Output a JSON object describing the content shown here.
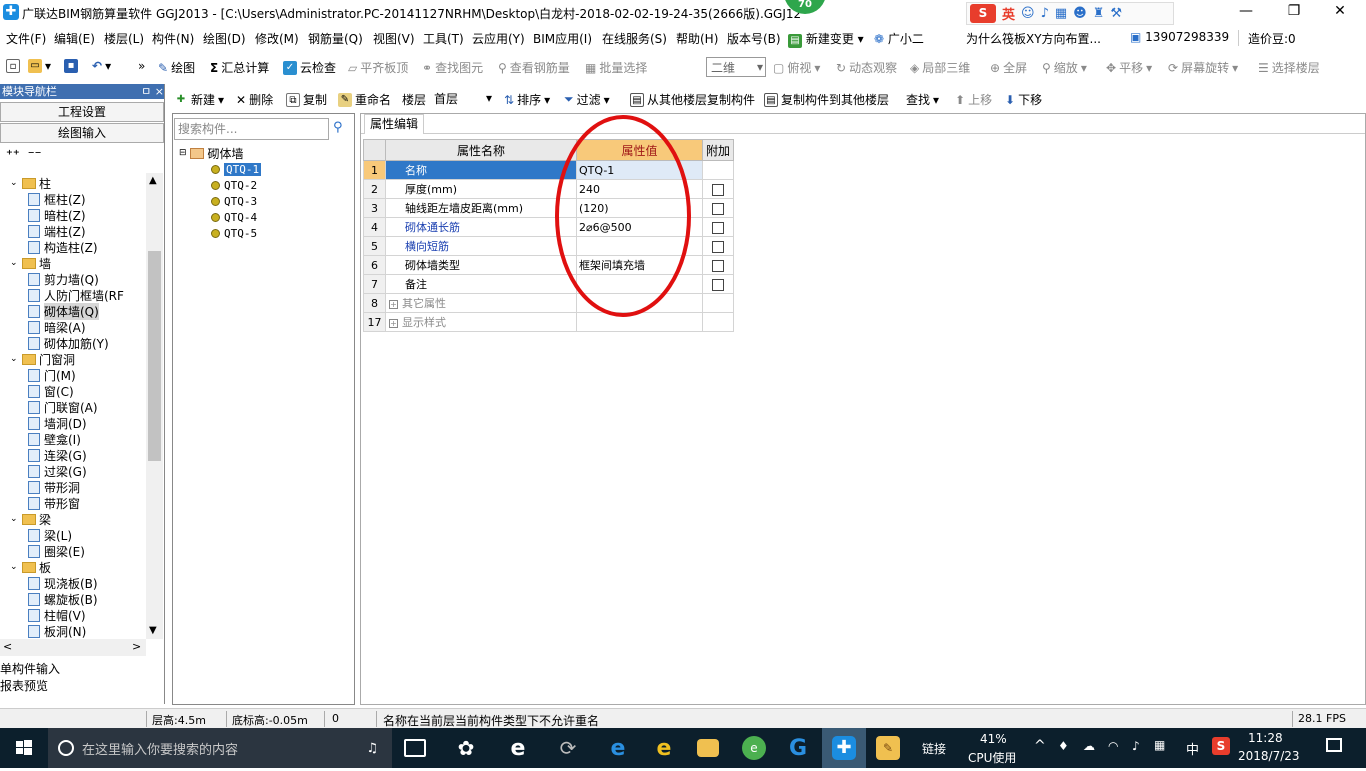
{
  "app": {
    "title": "广联达BIM钢筋算量软件 GGJ2013 - [C:\\Users\\Administrator.PC-20141127NRHM\\Desktop\\白龙村-2018-02-02-19-24-35(2666版).GGJ12",
    "badge": "70",
    "window_controls": [
      "—",
      "❐",
      "✕"
    ]
  },
  "ime": {
    "logo": "S",
    "mode": "英",
    "icons": [
      "smiley-icon",
      "microphone-icon",
      "keyboard-icon",
      "users-icon",
      "shirt-icon",
      "wrench-icon"
    ]
  },
  "menubar": {
    "items": [
      "文件(F)",
      "编辑(E)",
      "楼层(L)",
      "构件(N)",
      "绘图(D)",
      "修改(M)",
      "钢筋量(Q)",
      "视图(V)",
      "工具(T)",
      "云应用(Y)",
      "BIM应用(I)",
      "在线服务(S)",
      "帮助(H)",
      "版本号(B)"
    ],
    "new_change": "新建变更",
    "assistant": "广小二",
    "question": "为什么筏板XY方向布置...",
    "phone": "13907298339",
    "cost_bean": "造价豆:0"
  },
  "toolbar1": {
    "draw": "绘图",
    "sum_calc": "汇总计算",
    "cloud_check": "云检查",
    "align_slab": "平齐板顶",
    "find_element": "查找图元",
    "view_rebar": "查看钢筋量",
    "batch_select": "批量选择",
    "view_mode": "二维",
    "top_view": "俯视",
    "dynamic_view": "动态观察",
    "local_3d": "局部三维",
    "fullscreen": "全屏",
    "zoom": "缩放",
    "pan": "平移",
    "rotate": "屏幕旋转",
    "select_floor": "选择楼层"
  },
  "toolbar2": {
    "new": "新建",
    "delete": "删除",
    "copy": "复制",
    "rename": "重命名",
    "floor_label": "楼层",
    "floor_value": "首层",
    "sort": "排序",
    "filter": "过滤",
    "copy_from_floor": "从其他楼层复制构件",
    "copy_to_floor": "复制构件到其他楼层",
    "find": "查找",
    "move_up": "上移",
    "move_down": "下移"
  },
  "leftnav": {
    "title": "模块导航栏",
    "header_icons": "ㅁ ×",
    "btn_project_settings": "工程设置",
    "btn_draw_input": "绘图输入",
    "btn_single_input": "单构件输入",
    "btn_report_preview": "报表预览",
    "tree": [
      {
        "label": "柱",
        "level": 0,
        "folder": true
      },
      {
        "label": "框柱(Z)",
        "level": 1
      },
      {
        "label": "暗柱(Z)",
        "level": 1
      },
      {
        "label": "端柱(Z)",
        "level": 1
      },
      {
        "label": "构造柱(Z)",
        "level": 1
      },
      {
        "label": "墙",
        "level": 0,
        "folder": true
      },
      {
        "label": "剪力墙(Q)",
        "level": 1
      },
      {
        "label": "人防门框墙(RF",
        "level": 1
      },
      {
        "label": "砌体墙(Q)",
        "level": 1,
        "selected": true
      },
      {
        "label": "暗梁(A)",
        "level": 1
      },
      {
        "label": "砌体加筋(Y)",
        "level": 1
      },
      {
        "label": "门窗洞",
        "level": 0,
        "folder": true
      },
      {
        "label": "门(M)",
        "level": 1
      },
      {
        "label": "窗(C)",
        "level": 1
      },
      {
        "label": "门联窗(A)",
        "level": 1
      },
      {
        "label": "墙洞(D)",
        "level": 1
      },
      {
        "label": "壁龛(I)",
        "level": 1
      },
      {
        "label": "连梁(G)",
        "level": 1
      },
      {
        "label": "过梁(G)",
        "level": 1
      },
      {
        "label": "带形洞",
        "level": 1
      },
      {
        "label": "带形窗",
        "level": 1
      },
      {
        "label": "梁",
        "level": 0,
        "folder": true
      },
      {
        "label": "梁(L)",
        "level": 1
      },
      {
        "label": "圈梁(E)",
        "level": 1
      },
      {
        "label": "板",
        "level": 0,
        "folder": true
      },
      {
        "label": "现浇板(B)",
        "level": 1
      },
      {
        "label": "螺旋板(B)",
        "level": 1
      },
      {
        "label": "柱帽(V)",
        "level": 1
      },
      {
        "label": "板洞(N)",
        "level": 1
      }
    ]
  },
  "components": {
    "search_placeholder": "搜索构件...",
    "root": "砌体墙",
    "items": [
      "QTQ-1",
      "QTQ-2",
      "QTQ-3",
      "QTQ-4",
      "QTQ-5"
    ],
    "selected": "QTQ-1"
  },
  "properties": {
    "tab": "属性编辑",
    "col_name": "属性名称",
    "col_value": "属性值",
    "col_extra": "附加",
    "rows": [
      {
        "num": "1",
        "name": "名称",
        "value": "QTQ-1",
        "checkbox": false,
        "style": "sel"
      },
      {
        "num": "2",
        "name": "厚度(mm)",
        "value": "240",
        "checkbox": true,
        "style": ""
      },
      {
        "num": "3",
        "name": "轴线距左墙皮距离(mm)",
        "value": "(120)",
        "checkbox": true,
        "style": ""
      },
      {
        "num": "4",
        "name": "砌体通长筋",
        "value": "2⌀6@500",
        "checkbox": true,
        "style": "blue"
      },
      {
        "num": "5",
        "name": "横向短筋",
        "value": "",
        "checkbox": true,
        "style": "blue"
      },
      {
        "num": "6",
        "name": "砌体墙类型",
        "value": "框架间填充墙",
        "checkbox": true,
        "style": ""
      },
      {
        "num": "7",
        "name": "备注",
        "value": "",
        "checkbox": true,
        "style": ""
      },
      {
        "num": "8",
        "name": "其它属性",
        "value": "",
        "checkbox": false,
        "style": "gray",
        "expandable": true
      },
      {
        "num": "17",
        "name": "显示样式",
        "value": "",
        "checkbox": false,
        "style": "gray",
        "expandable": true
      }
    ]
  },
  "status": {
    "floor_height": "层高:4.5m",
    "bottom_elev": "底标高:-0.05m",
    "count": "0",
    "message": "名称在当前层当前构件类型下不允许重名",
    "fps": "28.1 FPS"
  },
  "taskbar": {
    "search_placeholder": "在这里输入你要搜索的内容",
    "link": "链接",
    "cpu_percent": "41%",
    "cpu_label": "CPU使用",
    "ime": "中",
    "time": "11:28",
    "date": "2018/7/23"
  },
  "colors": {
    "nav_header": "#3f6fb0",
    "selected_row": "#2f78c8",
    "value_header": "#f8c97a",
    "annotation_circle": "#e01010",
    "taskbar": "#0c1f2c"
  }
}
